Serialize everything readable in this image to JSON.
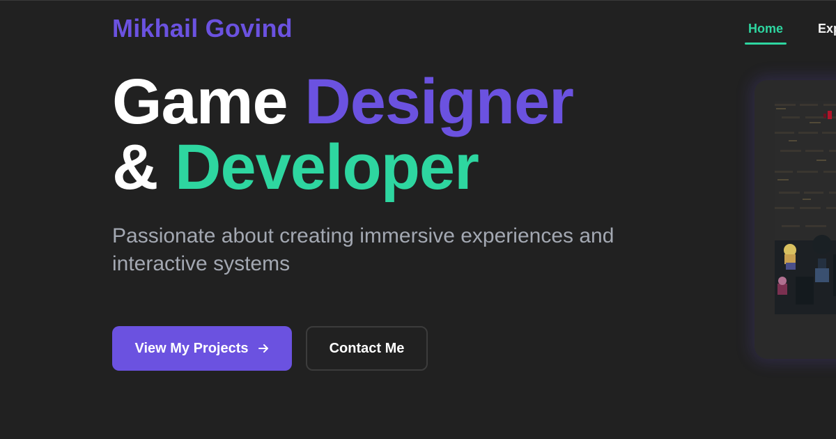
{
  "header": {
    "brand": "Mikhail Govind",
    "nav": {
      "home": "Home",
      "partial": "Exp"
    }
  },
  "hero": {
    "headline_line1_part1": "Game",
    "headline_line1_part2": "Designer",
    "headline_line2_part1": "&",
    "headline_line2_part2": "Developer",
    "subtitle": "Passionate about creating immersive experiences and interactive systems"
  },
  "actions": {
    "primary": "View My Projects",
    "primary_icon": "arrow-right-icon",
    "secondary": "Contact Me"
  },
  "colors": {
    "background": "#212121",
    "brand_violet": "#6b52e0",
    "accent_green": "#2ed6a0",
    "text_muted": "#a3a8b2"
  },
  "preview": {
    "name": "game-preview-image"
  }
}
